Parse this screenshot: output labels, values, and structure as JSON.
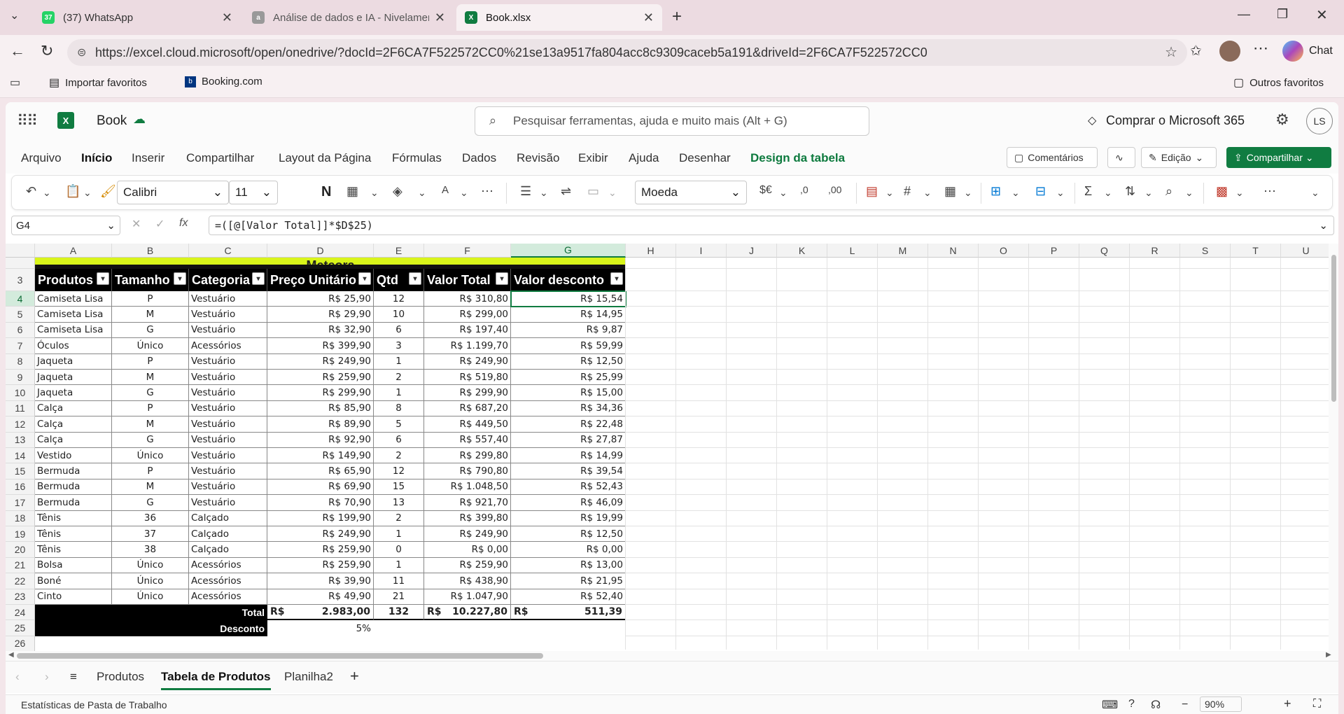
{
  "browser": {
    "tabs": [
      {
        "label": "(37) WhatsApp",
        "badge": "37"
      },
      {
        "label": "Análise de dados e IA - Nivelamen"
      },
      {
        "label": "Book.xlsx"
      }
    ],
    "url": "https://excel.cloud.microsoft/open/onedrive/?docId=2F6CA7F522572CC0%21se13a9517fa804acc8c9309caceb5a191&driveId=2F6CA7F522572CC0",
    "bookmarks": [
      "Importar favoritos",
      "Booking.com"
    ],
    "other_favorites": "Outros favoritos",
    "chat": "Chat"
  },
  "app": {
    "title": "Book",
    "search_placeholder": "Pesquisar ferramentas, ajuda e muito mais (Alt + G)",
    "buy": "Comprar o Microsoft 365",
    "avatar": "LS",
    "menus": [
      "Arquivo",
      "Início",
      "Inserir",
      "Compartilhar",
      "Layout da Página",
      "Fórmulas",
      "Dados",
      "Revisão",
      "Exibir",
      "Ajuda",
      "Desenhar",
      "Design da tabela"
    ],
    "comments": "Comentários",
    "edit": "Edição",
    "share": "Compartilhar"
  },
  "ribbon": {
    "font": "Calibri",
    "size": "11",
    "bold": "N",
    "number_format": "Moeda"
  },
  "formula_bar": {
    "cell": "G4",
    "formula": "=([@[Valor Total]]*$D$25)"
  },
  "sheet": {
    "columns": [
      "A",
      "B",
      "C",
      "D",
      "E",
      "F",
      "G",
      "H",
      "I",
      "J",
      "K",
      "L",
      "M",
      "N",
      "O",
      "P",
      "Q",
      "R",
      "S",
      "T",
      "U"
    ],
    "title": "Meteora",
    "headers": [
      "Produtos",
      "Tamanho",
      "Categoria",
      "Preço Unitário",
      "Qtd",
      "Valor Total",
      "Valor desconto"
    ],
    "rows": [
      [
        "4",
        "Camiseta Lisa",
        "P",
        "Vestuário",
        "R$ 25,90",
        "12",
        "R$ 310,80",
        "R$ 15,54"
      ],
      [
        "5",
        "Camiseta Lisa",
        "M",
        "Vestuário",
        "R$ 29,90",
        "10",
        "R$ 299,00",
        "R$ 14,95"
      ],
      [
        "6",
        "Camiseta Lisa",
        "G",
        "Vestuário",
        "R$ 32,90",
        "6",
        "R$ 197,40",
        "R$ 9,87"
      ],
      [
        "7",
        "Óculos",
        "Único",
        "Acessórios",
        "R$ 399,90",
        "3",
        "R$ 1.199,70",
        "R$ 59,99"
      ],
      [
        "8",
        "Jaqueta",
        "P",
        "Vestuário",
        "R$ 249,90",
        "1",
        "R$ 249,90",
        "R$ 12,50"
      ],
      [
        "9",
        "Jaqueta",
        "M",
        "Vestuário",
        "R$ 259,90",
        "2",
        "R$ 519,80",
        "R$ 25,99"
      ],
      [
        "10",
        "Jaqueta",
        "G",
        "Vestuário",
        "R$ 299,90",
        "1",
        "R$ 299,90",
        "R$ 15,00"
      ],
      [
        "11",
        "Calça",
        "P",
        "Vestuário",
        "R$ 85,90",
        "8",
        "R$ 687,20",
        "R$ 34,36"
      ],
      [
        "12",
        "Calça",
        "M",
        "Vestuário",
        "R$ 89,90",
        "5",
        "R$ 449,50",
        "R$ 22,48"
      ],
      [
        "13",
        "Calça",
        "G",
        "Vestuário",
        "R$ 92,90",
        "6",
        "R$ 557,40",
        "R$ 27,87"
      ],
      [
        "14",
        "Vestido",
        "Único",
        "Vestuário",
        "R$ 149,90",
        "2",
        "R$ 299,80",
        "R$ 14,99"
      ],
      [
        "15",
        "Bermuda",
        "P",
        "Vestuário",
        "R$ 65,90",
        "12",
        "R$ 790,80",
        "R$ 39,54"
      ],
      [
        "16",
        "Bermuda",
        "M",
        "Vestuário",
        "R$ 69,90",
        "15",
        "R$ 1.048,50",
        "R$ 52,43"
      ],
      [
        "17",
        "Bermuda",
        "G",
        "Vestuário",
        "R$ 70,90",
        "13",
        "R$ 921,70",
        "R$ 46,09"
      ],
      [
        "18",
        "Tênis",
        "36",
        "Calçado",
        "R$ 199,90",
        "2",
        "R$ 399,80",
        "R$ 19,99"
      ],
      [
        "19",
        "Tênis",
        "37",
        "Calçado",
        "R$ 249,90",
        "1",
        "R$ 249,90",
        "R$ 12,50"
      ],
      [
        "20",
        "Tênis",
        "38",
        "Calçado",
        "R$ 259,90",
        "0",
        "R$ 0,00",
        "R$ 0,00"
      ],
      [
        "21",
        "Bolsa",
        "Único",
        "Acessórios",
        "R$ 259,90",
        "1",
        "R$ 259,90",
        "R$ 13,00"
      ],
      [
        "22",
        "Boné",
        "Único",
        "Acessórios",
        "R$ 39,90",
        "11",
        "R$ 438,90",
        "R$ 21,95"
      ],
      [
        "23",
        "Cinto",
        "Único",
        "Acessórios",
        "R$ 49,90",
        "21",
        "R$ 1.047,90",
        "R$ 52,40"
      ]
    ],
    "total_row": {
      "label": "Total",
      "price_cur": "R$",
      "price": "2.983,00",
      "qty": "132",
      "total_cur": "R$",
      "total": "10.227,80",
      "disc_cur": "R$",
      "disc": "511,39"
    },
    "discount_row": {
      "label": "Desconto",
      "value": "5%"
    },
    "row_numbers_top": [
      "3"
    ],
    "row_after": [
      "24",
      "25",
      "26"
    ]
  },
  "sheet_tabs": [
    "Produtos",
    "Tabela de Produtos",
    "Planilha2"
  ],
  "status": {
    "left": "Estatísticas de Pasta de Trabalho",
    "zoom": "90%"
  },
  "colors": {
    "accent": "#107c41",
    "title_bg": "#d9f51a",
    "header_bg": "#000000"
  }
}
